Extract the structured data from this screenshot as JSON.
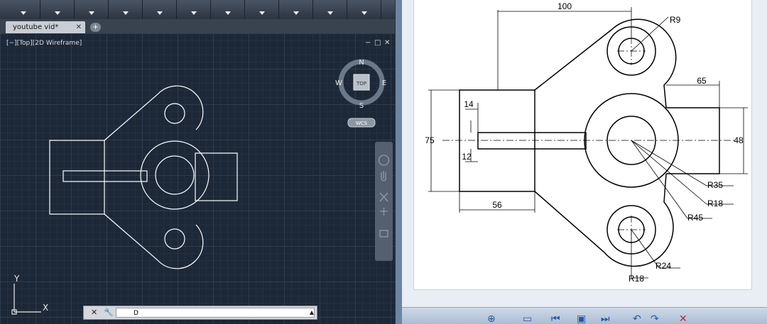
{
  "cad": {
    "tab_label": "youtube vid*",
    "tab_close": "✕",
    "tab_add": "+",
    "viewport_label": "[−][Top][2D Wireframe]",
    "win_controls": {
      "minimize": "−",
      "restore": "□",
      "close": "✕"
    },
    "viewcube": {
      "north": "N",
      "south": "S",
      "east": "E",
      "west": "W",
      "face": "TOP",
      "wcs": "WCS"
    },
    "ucs": {
      "y": "Y",
      "x": "X"
    },
    "command_line": {
      "close": "✕",
      "settings_icon": "wrench-icon",
      "prompt": "D"
    }
  },
  "reference": {
    "dimensions": {
      "width_100": "100",
      "width_65": "65",
      "width_56": "56",
      "height_75": "75",
      "height_48": "48",
      "dim_14": "14",
      "dim_12": "12",
      "radius_r9": "R9",
      "radius_r35": "R35",
      "radius_r18a": "R18",
      "radius_r45": "R45",
      "radius_r24": "R24",
      "radius_r18b": "R18"
    }
  },
  "colors": {
    "cad_bg": "#1d2837",
    "cad_line": "#ffffff",
    "paper": "#ffffff",
    "ink": "#000000",
    "viewer_bar": "#b8c8dc"
  }
}
